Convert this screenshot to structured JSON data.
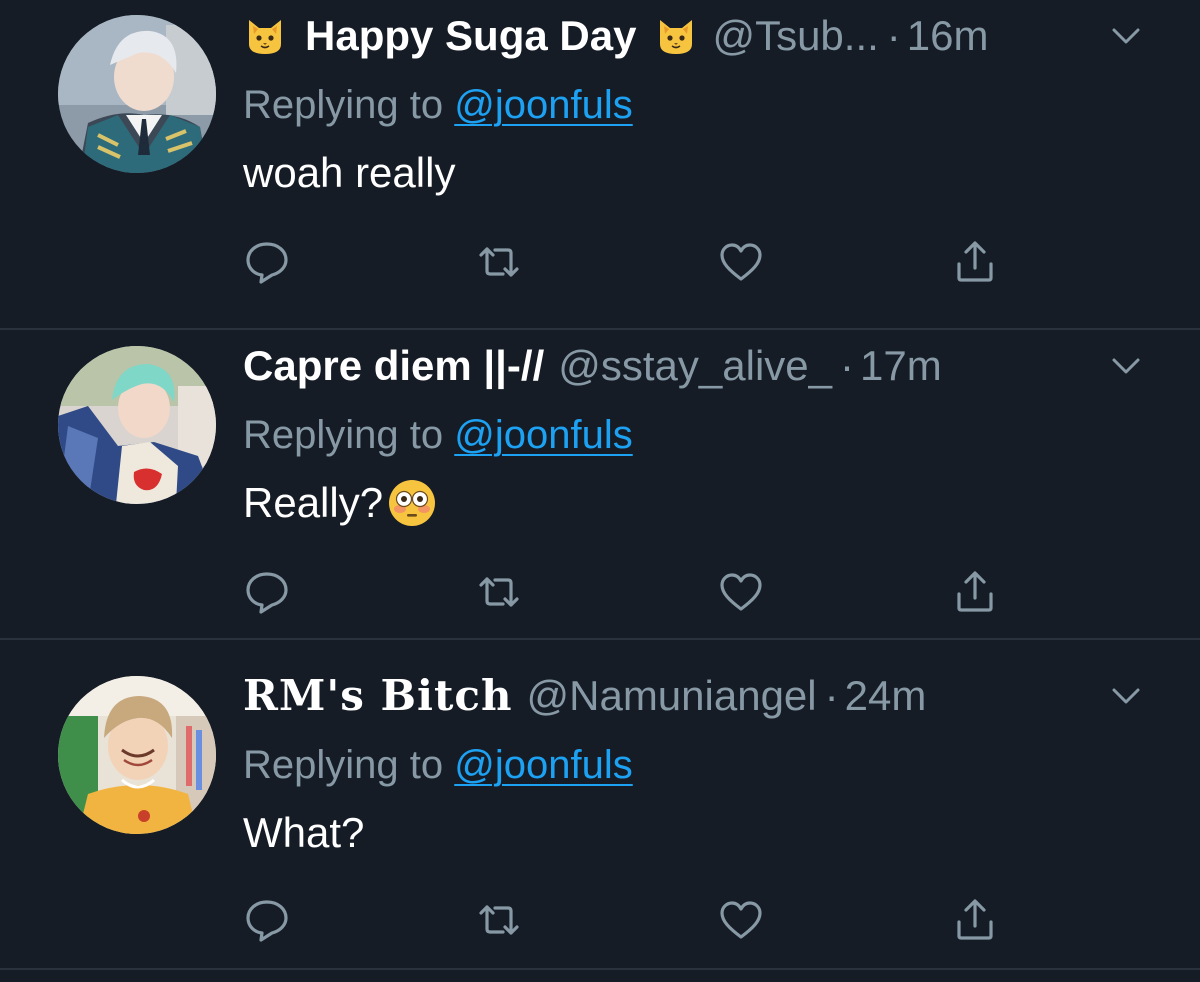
{
  "colors": {
    "background": "#151c26",
    "divider": "#2a323e",
    "secondary_text": "#8899a6",
    "link": "#1da1f2",
    "primary_text": "#ffffff"
  },
  "tweets": [
    {
      "display_name": "Happy Suga Day",
      "name_emoji": "cat-face-emoji",
      "handle": "@Tsub...",
      "separator": "·",
      "time": "16m",
      "replying_prefix": "Replying to",
      "replying_to": "@joonfuls",
      "text": "woah really",
      "text_emoji": ""
    },
    {
      "display_name": "Capre diem ||-//",
      "handle": "@sstay_alive_",
      "separator": "·",
      "time": "17m",
      "replying_prefix": "Replying to",
      "replying_to": "@joonfuls",
      "text": "Really?",
      "text_emoji": "flushed-face-emoji"
    },
    {
      "display_name": "RM's Bitch",
      "handle": "@Namuniangel",
      "separator": "·",
      "time": "24m",
      "replying_prefix": "Replying to",
      "replying_to": "@joonfuls",
      "text": "What?",
      "text_emoji": ""
    }
  ],
  "action_icons": [
    "reply-icon",
    "retweet-icon",
    "like-icon",
    "share-icon"
  ]
}
